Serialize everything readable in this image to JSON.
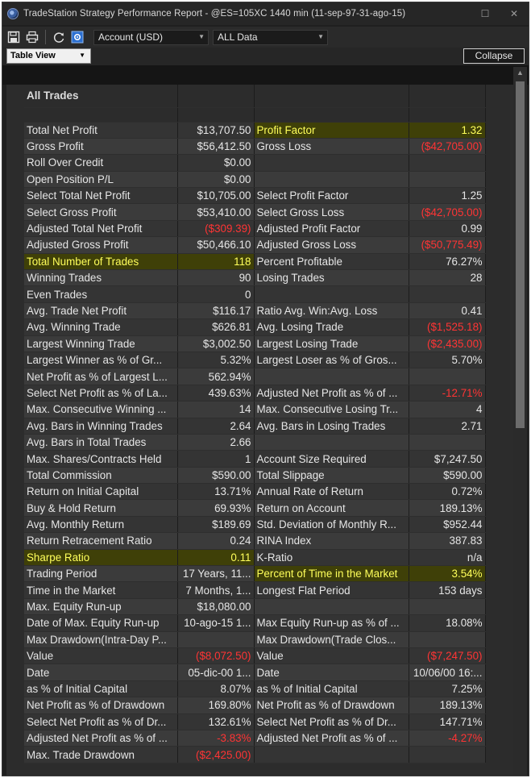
{
  "window": {
    "title": "TradeStation Strategy Performance Report - @ES=105XC 1440 min (11-sep-97-31-ago-15)",
    "minimize": "☐",
    "close": "✕"
  },
  "toolbar": {
    "icons": [
      "save-icon",
      "print-icon",
      "refresh-icon",
      "settings-icon"
    ],
    "account_select": "Account (USD)",
    "data_select": "ALL Data"
  },
  "viewbar": {
    "view_select": "Table View",
    "collapse_label": "Collapse"
  },
  "colors": {
    "negative": "#ff3434",
    "highlight_text": "#ffff5a",
    "highlight_bg": "#3f4008"
  },
  "report": {
    "section_title": "All Trades",
    "rows": [
      {
        "l1": "Total Net Profit",
        "v1": "$13,707.50",
        "l2": "Profit Factor",
        "v2": "1.32"
      },
      {
        "l1": "Gross Profit",
        "v1": "$56,412.50",
        "l2": "Gross Loss",
        "v2": "($42,705.00)"
      },
      {
        "l1": "Roll Over Credit",
        "v1": "$0.00",
        "l2": "",
        "v2": ""
      },
      {
        "l1": "Open Position P/L",
        "v1": "$0.00",
        "l2": "",
        "v2": ""
      },
      {
        "l1": "Select Total Net Profit",
        "v1": "$10,705.00",
        "l2": "Select Profit Factor",
        "v2": "1.25"
      },
      {
        "l1": "Select Gross Profit",
        "v1": "$53,410.00",
        "l2": "Select Gross Loss",
        "v2": "($42,705.00)"
      },
      {
        "l1": "Adjusted Total Net Profit",
        "v1": "($309.39)",
        "l2": "Adjusted Profit Factor",
        "v2": "0.99"
      },
      {
        "l1": "Adjusted Gross Profit",
        "v1": "$50,466.10",
        "l2": "Adjusted Gross Loss",
        "v2": "($50,775.49)"
      },
      {
        "l1": "Total Number of Trades",
        "v1": "118",
        "l2": "Percent Profitable",
        "v2": "76.27%"
      },
      {
        "l1": "Winning Trades",
        "v1": "90",
        "l2": "Losing Trades",
        "v2": "28"
      },
      {
        "l1": "Even Trades",
        "v1": "0",
        "l2": "",
        "v2": ""
      },
      {
        "l1": "Avg. Trade Net Profit",
        "v1": "$116.17",
        "l2": "Ratio Avg. Win:Avg. Loss",
        "v2": "0.41"
      },
      {
        "l1": "Avg. Winning Trade",
        "v1": "$626.81",
        "l2": "Avg. Losing Trade",
        "v2": "($1,525.18)"
      },
      {
        "l1": "Largest Winning Trade",
        "v1": "$3,002.50",
        "l2": "Largest Losing Trade",
        "v2": "($2,435.00)"
      },
      {
        "l1": "Largest Winner as % of Gr...",
        "v1": "5.32%",
        "l2": "Largest Loser as % of Gros...",
        "v2": "5.70%"
      },
      {
        "l1": "Net Profit as % of Largest L...",
        "v1": "562.94%",
        "l2": "",
        "v2": ""
      },
      {
        "l1": "Select Net Profit as % of La...",
        "v1": "439.63%",
        "l2": "Adjusted Net Profit as % of ...",
        "v2": "-12.71%"
      },
      {
        "l1": "Max. Consecutive Winning ...",
        "v1": "14",
        "l2": "Max. Consecutive Losing Tr...",
        "v2": "4"
      },
      {
        "l1": "Avg. Bars in Winning Trades",
        "v1": "2.64",
        "l2": "Avg. Bars in Losing Trades",
        "v2": "2.71"
      },
      {
        "l1": "Avg. Bars in Total Trades",
        "v1": "2.66",
        "l2": "",
        "v2": ""
      },
      {
        "l1": "Max. Shares/Contracts Held",
        "v1": "1",
        "l2": "Account Size Required",
        "v2": "$7,247.50"
      },
      {
        "l1": "Total Commission",
        "v1": "$590.00",
        "l2": "Total Slippage",
        "v2": "$590.00"
      },
      {
        "l1": "Return on Initial Capital",
        "v1": "13.71%",
        "l2": "Annual Rate of Return",
        "v2": "0.72%"
      },
      {
        "l1": "Buy & Hold Return",
        "v1": "69.93%",
        "l2": "Return on Account",
        "v2": "189.13%"
      },
      {
        "l1": "Avg. Monthly Return",
        "v1": "$189.69",
        "l2": "Std. Deviation of Monthly R...",
        "v2": "$952.44"
      },
      {
        "l1": "Return Retracement Ratio",
        "v1": "0.24",
        "l2": "RINA Index",
        "v2": "387.83"
      },
      {
        "l1": "Sharpe Ratio",
        "v1": "0.11",
        "l2": "K-Ratio",
        "v2": "n/a"
      },
      {
        "l1": "Trading Period",
        "v1": "17 Years, 11...",
        "l2": "Percent of Time in the Market",
        "v2": "3.54%"
      },
      {
        "l1": "Time in the Market",
        "v1": "7 Months, 1...",
        "l2": "Longest Flat Period",
        "v2": "153 days"
      },
      {
        "l1": "Max. Equity Run-up",
        "v1": "$18,080.00",
        "l2": "",
        "v2": ""
      },
      {
        "l1": "Date of Max. Equity Run-up",
        "v1": "10-ago-15 1...",
        "l2": "Max Equity Run-up as % of ...",
        "v2": "18.08%"
      },
      {
        "l1": "Max Drawdown(Intra-Day P...",
        "v1": "",
        "l2": "Max Drawdown(Trade Clos...",
        "v2": ""
      },
      {
        "l1": "Value",
        "v1": "($8,072.50)",
        "l2": "Value",
        "v2": "($7,247.50)"
      },
      {
        "l1": "Date",
        "v1": "05-dic-00 1...",
        "l2": "Date",
        "v2": "10/06/00 16:..."
      },
      {
        "l1": "as % of Initial Capital",
        "v1": "8.07%",
        "l2": "as % of Initial Capital",
        "v2": "7.25%"
      },
      {
        "l1": "Net Profit as % of Drawdown",
        "v1": "169.80%",
        "l2": "Net Profit as % of Drawdown",
        "v2": "189.13%"
      },
      {
        "l1": "Select Net Profit as % of Dr...",
        "v1": "132.61%",
        "l2": "Select Net Profit as % of Dr...",
        "v2": "147.71%"
      },
      {
        "l1": "Adjusted Net Profit as % of ...",
        "v1": "-3.83%",
        "l2": "Adjusted Net Profit as % of ...",
        "v2": "-4.27%"
      },
      {
        "l1": "Max. Trade Drawdown",
        "v1": "($2,425.00)",
        "l2": "",
        "v2": ""
      }
    ]
  }
}
